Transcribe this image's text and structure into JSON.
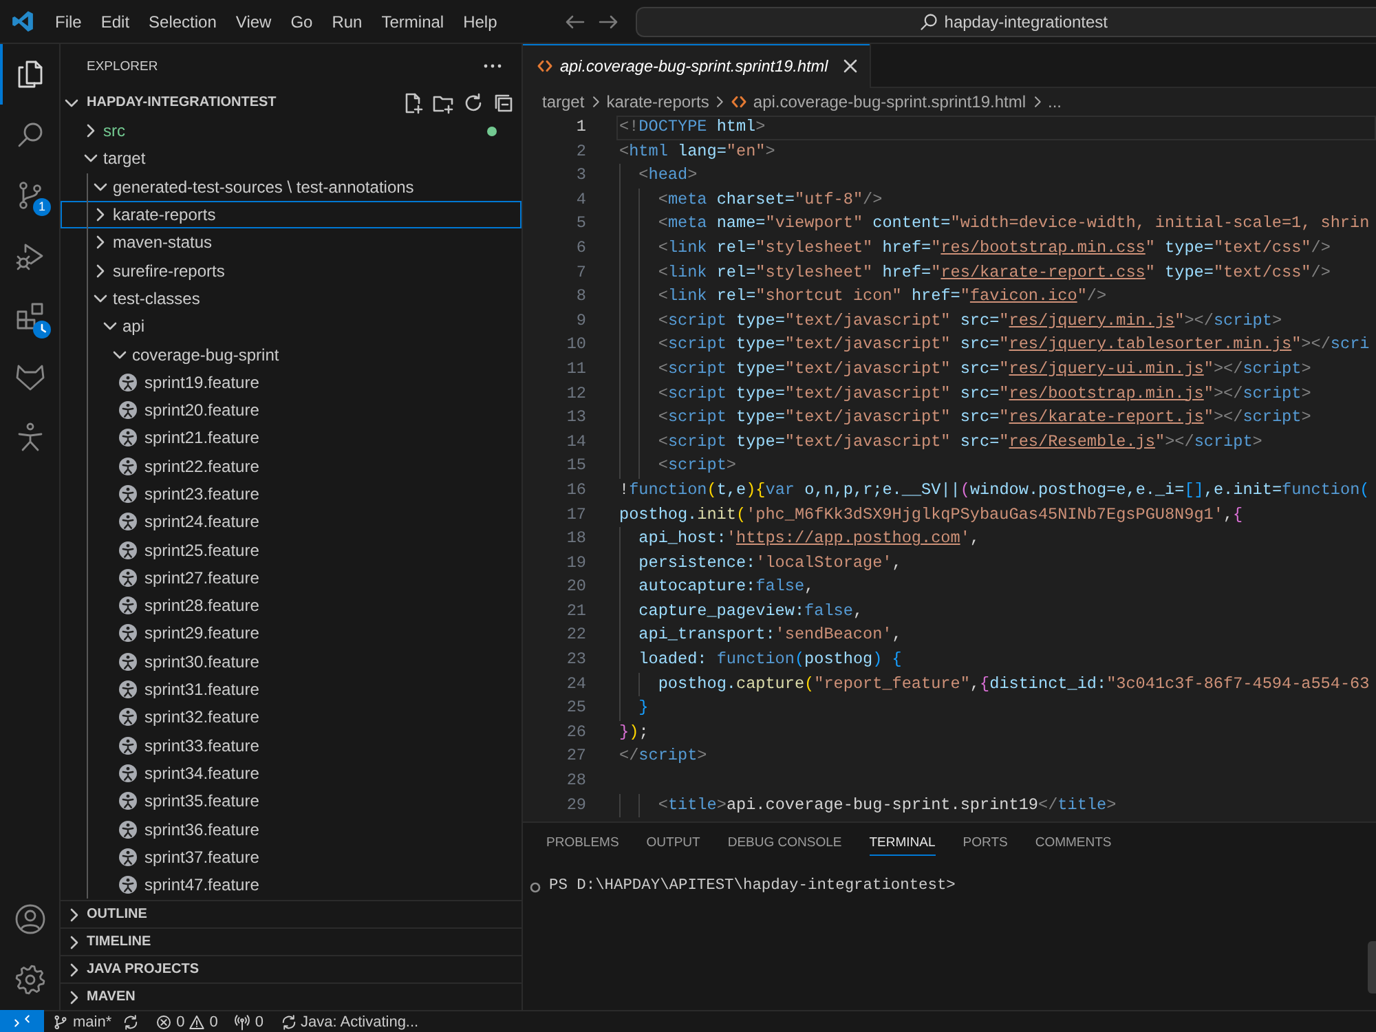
{
  "title_bar": {
    "menu": [
      "File",
      "Edit",
      "Selection",
      "View",
      "Go",
      "Run",
      "Terminal",
      "Help"
    ],
    "command_center": "hapday-integrationtest"
  },
  "activity_bar": {
    "top": [
      {
        "kind": "explorer",
        "selected": true,
        "busy": false
      },
      {
        "kind": "search",
        "selected": false,
        "busy": false
      },
      {
        "kind": "source-control",
        "selected": false,
        "busy": false,
        "badge": "1"
      },
      {
        "kind": "run-debug",
        "selected": false,
        "busy": false
      },
      {
        "kind": "extensions",
        "selected": false,
        "busy": true
      },
      {
        "kind": "fox",
        "selected": false,
        "busy": false
      },
      {
        "kind": "figure",
        "selected": false,
        "busy": false
      }
    ],
    "bottom": [
      {
        "kind": "account"
      },
      {
        "kind": "settings"
      }
    ]
  },
  "explorer": {
    "title": "EXPLORER",
    "root": {
      "label": "HAPDAY-INTEGRATIONTEST",
      "expanded": true,
      "children": [
        {
          "label": "src",
          "kind": "folder",
          "expanded": false,
          "focused": false,
          "color": "#73c991"
        },
        {
          "label": "target",
          "kind": "folder",
          "expanded": true,
          "focused": false,
          "children": [
            {
              "label": "generated-test-sources \\ test-annotations",
              "kind": "folder",
              "expanded": true,
              "focused": false
            },
            {
              "label": "karate-reports",
              "kind": "folder",
              "expanded": false,
              "focused": true
            },
            {
              "label": "maven-status",
              "kind": "folder",
              "expanded": false,
              "focused": false
            },
            {
              "label": "surefire-reports",
              "kind": "folder",
              "expanded": false,
              "focused": false
            },
            {
              "label": "test-classes",
              "kind": "folder",
              "expanded": true,
              "focused": false,
              "children": [
                {
                  "label": "api",
                  "kind": "folder",
                  "expanded": true,
                  "focused": false,
                  "children": [
                    {
                      "label": "coverage-bug-sprint",
                      "kind": "folder",
                      "expanded": true,
                      "focused": false,
                      "children": [
                        {
                          "label": "sprint19.feature",
                          "kind": "file",
                          "focused": false
                        },
                        {
                          "label": "sprint20.feature",
                          "kind": "file",
                          "focused": false
                        },
                        {
                          "label": "sprint21.feature",
                          "kind": "file",
                          "focused": false
                        },
                        {
                          "label": "sprint22.feature",
                          "kind": "file",
                          "focused": false
                        },
                        {
                          "label": "sprint23.feature",
                          "kind": "file",
                          "focused": false
                        },
                        {
                          "label": "sprint24.feature",
                          "kind": "file",
                          "focused": false
                        },
                        {
                          "label": "sprint25.feature",
                          "kind": "file",
                          "focused": false
                        },
                        {
                          "label": "sprint27.feature",
                          "kind": "file",
                          "focused": false
                        },
                        {
                          "label": "sprint28.feature",
                          "kind": "file",
                          "focused": false
                        },
                        {
                          "label": "sprint29.feature",
                          "kind": "file",
                          "focused": false
                        },
                        {
                          "label": "sprint30.feature",
                          "kind": "file",
                          "focused": false
                        },
                        {
                          "label": "sprint31.feature",
                          "kind": "file",
                          "focused": false
                        },
                        {
                          "label": "sprint32.feature",
                          "kind": "file",
                          "focused": false
                        },
                        {
                          "label": "sprint33.feature",
                          "kind": "file",
                          "focused": false
                        },
                        {
                          "label": "sprint34.feature",
                          "kind": "file",
                          "focused": false
                        },
                        {
                          "label": "sprint35.feature",
                          "kind": "file",
                          "focused": false
                        },
                        {
                          "label": "sprint36.feature",
                          "kind": "file",
                          "focused": false
                        },
                        {
                          "label": "sprint37.feature",
                          "kind": "file",
                          "focused": false
                        },
                        {
                          "label": "sprint47.feature",
                          "kind": "file",
                          "focused": false
                        }
                      ]
                    }
                  ]
                }
              ]
            }
          ]
        }
      ]
    },
    "sections": [
      {
        "label": "OUTLINE",
        "expanded": false
      },
      {
        "label": "TIMELINE",
        "expanded": false
      },
      {
        "label": "JAVA PROJECTS",
        "expanded": false
      },
      {
        "label": "MAVEN",
        "expanded": false
      }
    ]
  },
  "editor": {
    "tabs": [
      {
        "label": "api.coverage-bug-sprint.sprint19.html",
        "selected": true,
        "preview": true
      }
    ],
    "breadcrumbs": [
      {
        "label": "target",
        "kind": "folder"
      },
      {
        "label": "karate-reports",
        "kind": "folder"
      },
      {
        "label": "api.coverage-bug-sprint.sprint19.html",
        "kind": "file"
      },
      {
        "label": "...",
        "kind": "more"
      }
    ],
    "lines": [
      {
        "number": "1",
        "current": true,
        "tokens": [
          {
            "text": "<!",
            "kind": "punct"
          },
          {
            "text": "DOCTYPE",
            "kind": "tag"
          },
          {
            "text": " html",
            "kind": "attr"
          },
          {
            "text": ">",
            "kind": "punct"
          }
        ]
      },
      {
        "number": "2",
        "current": false,
        "tokens": [
          {
            "text": "<",
            "kind": "punct"
          },
          {
            "text": "html",
            "kind": "tag"
          },
          {
            "text": " lang=",
            "kind": "attr"
          },
          {
            "text": "\"en\"",
            "kind": "str"
          },
          {
            "text": ">",
            "kind": "punct"
          }
        ]
      },
      {
        "number": "3",
        "current": false,
        "tokens": [
          {
            "text": "  <",
            "kind": "punct"
          },
          {
            "text": "head",
            "kind": "tag"
          },
          {
            "text": ">",
            "kind": "punct"
          }
        ]
      },
      {
        "number": "4",
        "current": false,
        "tokens": [
          {
            "text": "    <",
            "kind": "punct"
          },
          {
            "text": "meta",
            "kind": "tag"
          },
          {
            "text": " charset=",
            "kind": "attr"
          },
          {
            "text": "\"utf-8\"",
            "kind": "str"
          },
          {
            "text": "/>",
            "kind": "punct"
          }
        ]
      },
      {
        "number": "5",
        "current": false,
        "tokens": [
          {
            "text": "    <",
            "kind": "punct"
          },
          {
            "text": "meta",
            "kind": "tag"
          },
          {
            "text": " name=",
            "kind": "attr"
          },
          {
            "text": "\"viewport\"",
            "kind": "str"
          },
          {
            "text": " content=",
            "kind": "attr"
          },
          {
            "text": "\"width=device-width, initial-scale=1, shrin",
            "kind": "str"
          }
        ]
      },
      {
        "number": "6",
        "current": false,
        "tokens": [
          {
            "text": "    <",
            "kind": "punct"
          },
          {
            "text": "link",
            "kind": "tag"
          },
          {
            "text": " rel=",
            "kind": "attr"
          },
          {
            "text": "\"stylesheet\"",
            "kind": "str"
          },
          {
            "text": " href=",
            "kind": "attr"
          },
          {
            "text": "\"",
            "kind": "str"
          },
          {
            "text": "res/bootstrap.min.css",
            "kind": "link"
          },
          {
            "text": "\"",
            "kind": "str"
          },
          {
            "text": " type=",
            "kind": "attr"
          },
          {
            "text": "\"text/css\"",
            "kind": "str"
          },
          {
            "text": "/>",
            "kind": "punct"
          }
        ]
      },
      {
        "number": "7",
        "current": false,
        "tokens": [
          {
            "text": "    <",
            "kind": "punct"
          },
          {
            "text": "link",
            "kind": "tag"
          },
          {
            "text": " rel=",
            "kind": "attr"
          },
          {
            "text": "\"stylesheet\"",
            "kind": "str"
          },
          {
            "text": " href=",
            "kind": "attr"
          },
          {
            "text": "\"",
            "kind": "str"
          },
          {
            "text": "res/karate-report.css",
            "kind": "link"
          },
          {
            "text": "\"",
            "kind": "str"
          },
          {
            "text": " type=",
            "kind": "attr"
          },
          {
            "text": "\"text/css\"",
            "kind": "str"
          },
          {
            "text": "/>",
            "kind": "punct"
          }
        ]
      },
      {
        "number": "8",
        "current": false,
        "tokens": [
          {
            "text": "    <",
            "kind": "punct"
          },
          {
            "text": "link",
            "kind": "tag"
          },
          {
            "text": " rel=",
            "kind": "attr"
          },
          {
            "text": "\"shortcut icon\"",
            "kind": "str"
          },
          {
            "text": " href=",
            "kind": "attr"
          },
          {
            "text": "\"",
            "kind": "str"
          },
          {
            "text": "favicon.ico",
            "kind": "link"
          },
          {
            "text": "\"",
            "kind": "str"
          },
          {
            "text": "/>",
            "kind": "punct"
          }
        ]
      },
      {
        "number": "9",
        "current": false,
        "tokens": [
          {
            "text": "    <",
            "kind": "punct"
          },
          {
            "text": "script",
            "kind": "tag"
          },
          {
            "text": " type=",
            "kind": "attr"
          },
          {
            "text": "\"text/javascript\"",
            "kind": "str"
          },
          {
            "text": " src=",
            "kind": "attr"
          },
          {
            "text": "\"",
            "kind": "str"
          },
          {
            "text": "res/jquery.min.js",
            "kind": "link"
          },
          {
            "text": "\"",
            "kind": "str"
          },
          {
            "text": "></",
            "kind": "punct"
          },
          {
            "text": "script",
            "kind": "tag"
          },
          {
            "text": ">",
            "kind": "punct"
          }
        ]
      },
      {
        "number": "10",
        "current": false,
        "tokens": [
          {
            "text": "    <",
            "kind": "punct"
          },
          {
            "text": "script",
            "kind": "tag"
          },
          {
            "text": " type=",
            "kind": "attr"
          },
          {
            "text": "\"text/javascript\"",
            "kind": "str"
          },
          {
            "text": " src=",
            "kind": "attr"
          },
          {
            "text": "\"",
            "kind": "str"
          },
          {
            "text": "res/jquery.tablesorter.min.js",
            "kind": "link"
          },
          {
            "text": "\"",
            "kind": "str"
          },
          {
            "text": "></",
            "kind": "punct"
          },
          {
            "text": "scri",
            "kind": "tag"
          }
        ]
      },
      {
        "number": "11",
        "current": false,
        "tokens": [
          {
            "text": "    <",
            "kind": "punct"
          },
          {
            "text": "script",
            "kind": "tag"
          },
          {
            "text": " type=",
            "kind": "attr"
          },
          {
            "text": "\"text/javascript\"",
            "kind": "str"
          },
          {
            "text": " src=",
            "kind": "attr"
          },
          {
            "text": "\"",
            "kind": "str"
          },
          {
            "text": "res/jquery-ui.min.js",
            "kind": "link"
          },
          {
            "text": "\"",
            "kind": "str"
          },
          {
            "text": "></",
            "kind": "punct"
          },
          {
            "text": "script",
            "kind": "tag"
          },
          {
            "text": ">",
            "kind": "punct"
          }
        ]
      },
      {
        "number": "12",
        "current": false,
        "tokens": [
          {
            "text": "    <",
            "kind": "punct"
          },
          {
            "text": "script",
            "kind": "tag"
          },
          {
            "text": " type=",
            "kind": "attr"
          },
          {
            "text": "\"text/javascript\"",
            "kind": "str"
          },
          {
            "text": " src=",
            "kind": "attr"
          },
          {
            "text": "\"",
            "kind": "str"
          },
          {
            "text": "res/bootstrap.min.js",
            "kind": "link"
          },
          {
            "text": "\"",
            "kind": "str"
          },
          {
            "text": "></",
            "kind": "punct"
          },
          {
            "text": "script",
            "kind": "tag"
          },
          {
            "text": ">",
            "kind": "punct"
          }
        ]
      },
      {
        "number": "13",
        "current": false,
        "tokens": [
          {
            "text": "    <",
            "kind": "punct"
          },
          {
            "text": "script",
            "kind": "tag"
          },
          {
            "text": " type=",
            "kind": "attr"
          },
          {
            "text": "\"text/javascript\"",
            "kind": "str"
          },
          {
            "text": " src=",
            "kind": "attr"
          },
          {
            "text": "\"",
            "kind": "str"
          },
          {
            "text": "res/karate-report.js",
            "kind": "link"
          },
          {
            "text": "\"",
            "kind": "str"
          },
          {
            "text": "></",
            "kind": "punct"
          },
          {
            "text": "script",
            "kind": "tag"
          },
          {
            "text": ">",
            "kind": "punct"
          }
        ]
      },
      {
        "number": "14",
        "current": false,
        "tokens": [
          {
            "text": "    <",
            "kind": "punct"
          },
          {
            "text": "script",
            "kind": "tag"
          },
          {
            "text": " type=",
            "kind": "attr"
          },
          {
            "text": "\"text/javascript\"",
            "kind": "str"
          },
          {
            "text": " src=",
            "kind": "attr"
          },
          {
            "text": "\"",
            "kind": "str"
          },
          {
            "text": "res/Resemble.js",
            "kind": "link"
          },
          {
            "text": "\"",
            "kind": "str"
          },
          {
            "text": "></",
            "kind": "punct"
          },
          {
            "text": "script",
            "kind": "tag"
          },
          {
            "text": ">",
            "kind": "punct"
          }
        ]
      },
      {
        "number": "15",
        "current": false,
        "tokens": [
          {
            "text": "    <",
            "kind": "punct"
          },
          {
            "text": "script",
            "kind": "tag"
          },
          {
            "text": ">",
            "kind": "punct"
          }
        ]
      },
      {
        "number": "16",
        "current": false,
        "tokens": [
          {
            "text": "!",
            "kind": "text"
          },
          {
            "text": "function",
            "kind": "kw"
          },
          {
            "text": "(",
            "kind": "b1"
          },
          {
            "text": "t,e",
            "kind": "var"
          },
          {
            "text": ")",
            "kind": "b1"
          },
          {
            "text": "{",
            "kind": "b1"
          },
          {
            "text": "var",
            "kind": "kw"
          },
          {
            "text": " o,n,p,r;e.__SV||",
            "kind": "var"
          },
          {
            "text": "(",
            "kind": "b2"
          },
          {
            "text": "window.posthog=e,e._i=",
            "kind": "var"
          },
          {
            "text": "[]",
            "kind": "b3"
          },
          {
            "text": ",e.init=",
            "kind": "var"
          },
          {
            "text": "function",
            "kind": "kw"
          },
          {
            "text": "(",
            "kind": "b3"
          }
        ]
      },
      {
        "number": "17",
        "current": false,
        "tokens": [
          {
            "text": "posthog.",
            "kind": "var"
          },
          {
            "text": "init",
            "kind": "fn"
          },
          {
            "text": "(",
            "kind": "b1"
          },
          {
            "text": "'phc_M6fKk3dSX9HjglkqPSybauGas45NINb7EgsPGU8N9g1'",
            "kind": "str"
          },
          {
            "text": ",",
            "kind": "text"
          },
          {
            "text": "{",
            "kind": "b2"
          }
        ]
      },
      {
        "number": "18",
        "current": false,
        "tokens": [
          {
            "text": "  api_host:",
            "kind": "var"
          },
          {
            "text": "'",
            "kind": "str"
          },
          {
            "text": "https://app.posthog.com",
            "kind": "link"
          },
          {
            "text": "'",
            "kind": "str"
          },
          {
            "text": ",",
            "kind": "text"
          }
        ]
      },
      {
        "number": "19",
        "current": false,
        "tokens": [
          {
            "text": "  persistence:",
            "kind": "var"
          },
          {
            "text": "'localStorage'",
            "kind": "str"
          },
          {
            "text": ",",
            "kind": "text"
          }
        ]
      },
      {
        "number": "20",
        "current": false,
        "tokens": [
          {
            "text": "  autocapture:",
            "kind": "var"
          },
          {
            "text": "false",
            "kind": "kw"
          },
          {
            "text": ",",
            "kind": "text"
          }
        ]
      },
      {
        "number": "21",
        "current": false,
        "tokens": [
          {
            "text": "  capture_pageview:",
            "kind": "var"
          },
          {
            "text": "false",
            "kind": "kw"
          },
          {
            "text": ",",
            "kind": "text"
          }
        ]
      },
      {
        "number": "22",
        "current": false,
        "tokens": [
          {
            "text": "  api_transport:",
            "kind": "var"
          },
          {
            "text": "'sendBeacon'",
            "kind": "str"
          },
          {
            "text": ",",
            "kind": "text"
          }
        ]
      },
      {
        "number": "23",
        "current": false,
        "tokens": [
          {
            "text": "  loaded: ",
            "kind": "var"
          },
          {
            "text": "function",
            "kind": "kw"
          },
          {
            "text": "(",
            "kind": "b3"
          },
          {
            "text": "posthog",
            "kind": "var"
          },
          {
            "text": ") {",
            "kind": "b3"
          }
        ]
      },
      {
        "number": "24",
        "current": false,
        "tokens": [
          {
            "text": "    posthog.",
            "kind": "var"
          },
          {
            "text": "capture",
            "kind": "fn"
          },
          {
            "text": "(",
            "kind": "b1"
          },
          {
            "text": "\"report_feature\"",
            "kind": "str"
          },
          {
            "text": ",",
            "kind": "text"
          },
          {
            "text": "{",
            "kind": "b2"
          },
          {
            "text": "distinct_id:",
            "kind": "var"
          },
          {
            "text": "\"3c041c3f-86f7-4594-a554-63",
            "kind": "str"
          }
        ]
      },
      {
        "number": "25",
        "current": false,
        "tokens": [
          {
            "text": "  }",
            "kind": "b3"
          }
        ]
      },
      {
        "number": "26",
        "current": false,
        "tokens": [
          {
            "text": "}",
            "kind": "b2"
          },
          {
            "text": ")",
            "kind": "b1"
          },
          {
            "text": ";",
            "kind": "text"
          }
        ]
      },
      {
        "number": "27",
        "current": false,
        "tokens": [
          {
            "text": "</",
            "kind": "punct"
          },
          {
            "text": "script",
            "kind": "tag"
          },
          {
            "text": ">",
            "kind": "punct"
          }
        ]
      },
      {
        "number": "28",
        "current": false
      },
      {
        "number": "29",
        "current": false,
        "tokens": [
          {
            "text": "    <",
            "kind": "punct"
          },
          {
            "text": "title",
            "kind": "tag"
          },
          {
            "text": ">",
            "kind": "punct"
          },
          {
            "text": "api.coverage-bug-sprint.sprint19",
            "kind": "text"
          },
          {
            "text": "</",
            "kind": "punct"
          },
          {
            "text": "title",
            "kind": "tag"
          },
          {
            "text": ">",
            "kind": "punct"
          }
        ]
      }
    ]
  },
  "panel": {
    "tabs": [
      {
        "label": "PROBLEMS",
        "selected": false
      },
      {
        "label": "OUTPUT",
        "selected": false
      },
      {
        "label": "DEBUG CONSOLE",
        "selected": false
      },
      {
        "label": "TERMINAL",
        "selected": true
      },
      {
        "label": "PORTS",
        "selected": false
      },
      {
        "label": "COMMENTS",
        "selected": false
      }
    ],
    "terminal": {
      "prompt": "PS D:\\HAPDAY\\APITEST\\hapday-integrationtest>"
    }
  },
  "status_bar": {
    "branch": "main*",
    "errors": "0",
    "warnings": "0",
    "ports": "0",
    "java_status": "Java: Activating..."
  }
}
